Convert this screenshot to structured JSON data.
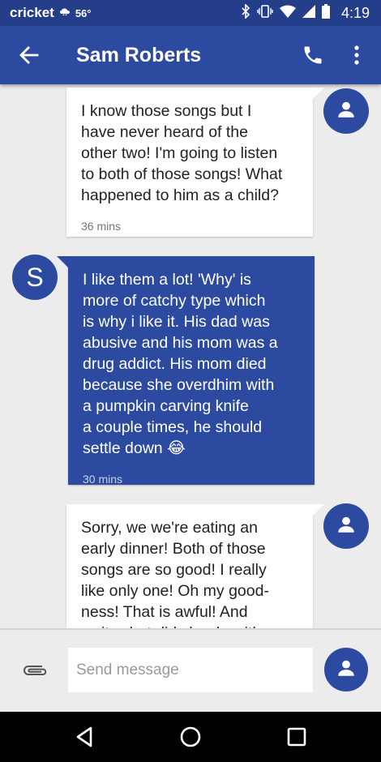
{
  "status_bar": {
    "carrier": "cricket",
    "temperature": "56°",
    "time": "4:19"
  },
  "app_bar": {
    "title": "Sam Roberts",
    "icons": [
      "back-arrow-icon",
      "phone-icon",
      "more-vert-icon"
    ]
  },
  "messages": [
    {
      "direction": "incoming",
      "lines": [
        "I know those songs but I",
        "have never heard of the",
        "other two! I'm going to listen",
        "to both of those songs! What",
        "happened to him as a child?"
      ],
      "time": "36 mins"
    },
    {
      "direction": "outgoing",
      "sender_initial": "S",
      "lines": [
        "I like them a lot! 'Why' is",
        "more of catchy type which",
        "is why i like it. His dad was",
        "abusive and his mom was a",
        "drug addict. His mom died",
        "because she overdhim with",
        "a pumpkin carving knife",
        "a couple times, he should",
        "settle down"
      ],
      "emoji": "😂",
      "time": "30 mins"
    },
    {
      "direction": "incoming",
      "lines": [
        "Sorry, we we're eating an",
        "early dinner! Both of those",
        "songs are so good! I really",
        "like only one! Oh my good-",
        "ness! That is awful! And",
        "wait, what did she do with a"
      ],
      "time": ""
    }
  ],
  "compose": {
    "placeholder": "Send message",
    "value": ""
  },
  "colors": {
    "primary": "#2b4aa0",
    "status_bar": "#253e8a",
    "background": "#ececec"
  }
}
